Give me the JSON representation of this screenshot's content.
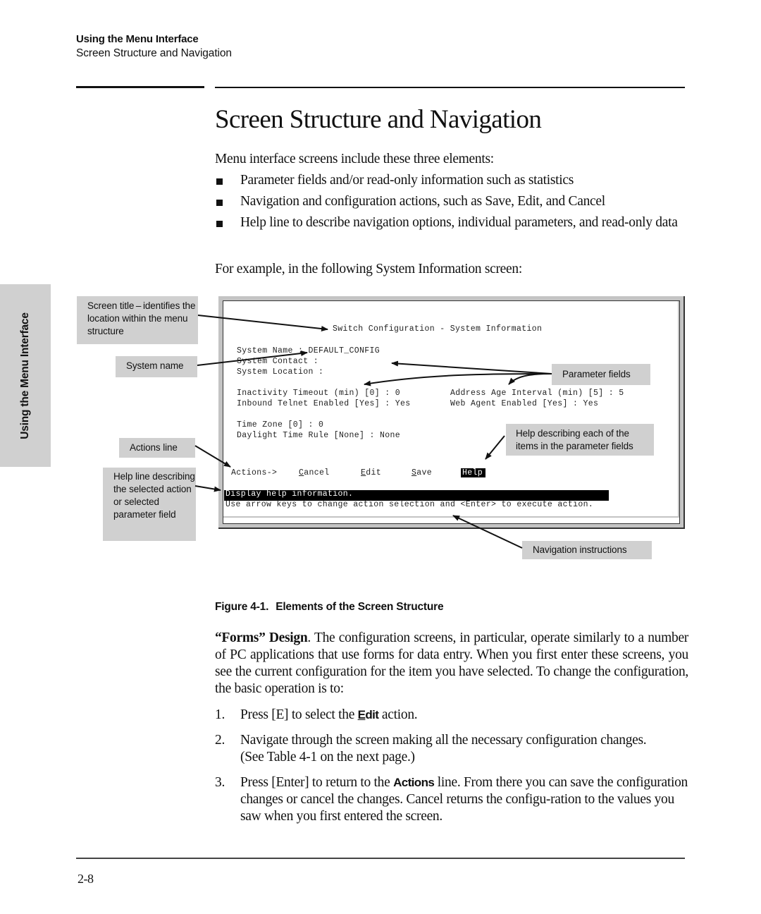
{
  "header": {
    "chapter": "Using the Menu Interface",
    "section": "Screen Structure and Navigation"
  },
  "side_tab": {
    "label": "Using the Menu Interface"
  },
  "page_title": "Screen Structure and Navigation",
  "intro": "Menu interface screens include these three elements:",
  "bullets": [
    "Parameter fields and/or read-only information such as statistics",
    "Navigation and configuration actions, such as Save, Edit, and Cancel",
    "Help line to describe navigation options, individual parameters, and read-only data"
  ],
  "example_intro": "For example, in the following System Information screen:",
  "figure": {
    "callouts": {
      "screen_title": "Screen title – identifies the location within the menu structure",
      "system_name": "System name",
      "actions_line": "Actions line",
      "help_line": "Help line describing the selected action or selected parameter field",
      "parameter_fields": "Parameter fields",
      "help_describing": "Help describing each of the items in the parameter fields",
      "navigation_instructions": "Navigation instructions"
    },
    "terminal": {
      "title": "Switch Configuration - System Information",
      "fields": {
        "system_name": "System Name : DEFAULT_CONFIG",
        "system_contact": "System Contact :",
        "system_location": "System Location :",
        "inactivity_timeout": "Inactivity Timeout (min) [0] : 0",
        "inbound_telnet": "Inbound Telnet Enabled [Yes] : Yes",
        "address_age": "Address Age Interval (min) [5] : 5",
        "web_agent": "Web Agent Enabled [Yes] : Yes",
        "time_zone": "Time Zone [0] : 0",
        "daylight_rule": "Daylight Time Rule [None] : None"
      },
      "actions_label": "Actions->",
      "actions": [
        {
          "hotkey": "C",
          "rest": "ancel"
        },
        {
          "hotkey": "E",
          "rest": "dit"
        },
        {
          "hotkey": "S",
          "rest": "ave"
        },
        {
          "hotkey": "",
          "rest": "Help",
          "selected": true
        }
      ],
      "help_line": "Display help information.",
      "nav_line": "Use arrow keys to change action selection and <Enter> to execute action."
    },
    "caption_number": "Figure 4-1.",
    "caption_title": "Elements of the Screen Structure"
  },
  "forms_para": {
    "lead": "“Forms” Design",
    "text": ". The configuration screens, in particular, operate similarly to a number of PC applications that use forms for data entry. When you first enter these screens, you see the current configuration for the item you have selected. To change the configuration, the basic operation is to:"
  },
  "steps": [
    {
      "num": "1.",
      "pre": "Press [E] to select the ",
      "ref_hotkey": "E",
      "ref_rest": "dit",
      "post": " action."
    },
    {
      "num": "2.",
      "text": "Navigate through the screen making all the necessary configuration changes. (See Table 4-1 on the next page.)"
    },
    {
      "num": "3.",
      "pre": "Press [Enter] to return to the ",
      "ref": "Actions",
      "post": " line. From there you can save the configuration changes or cancel the changes. Cancel returns the configu-ration to the values you saw when you first entered the screen."
    }
  ],
  "footer": {
    "page_number": "2-8"
  }
}
